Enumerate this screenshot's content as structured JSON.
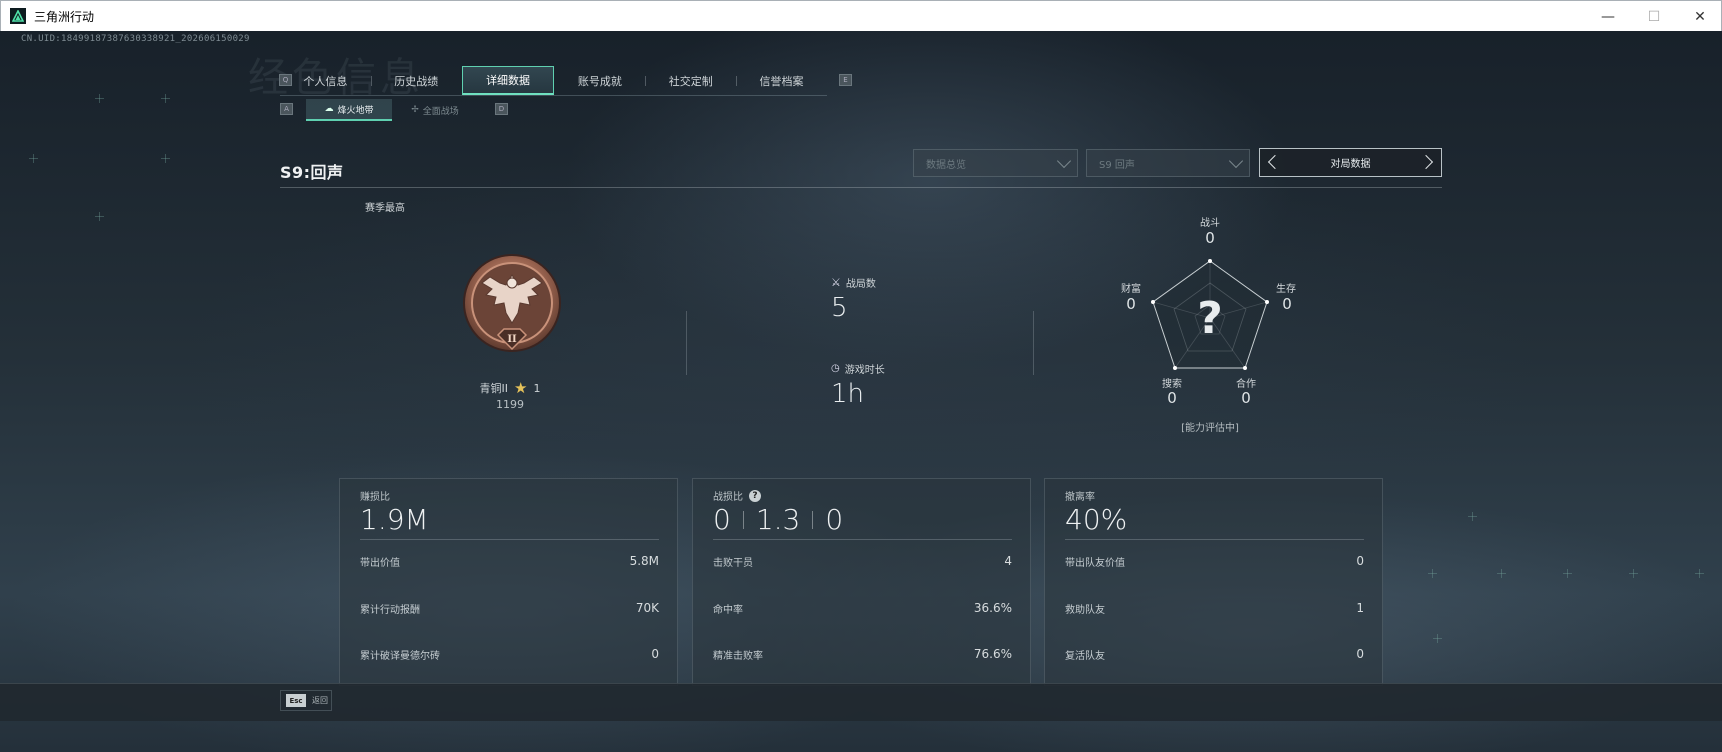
{
  "window": {
    "title": "三角洲行动",
    "minimize": "—",
    "maximize": "☐",
    "close": "✕"
  },
  "uid": "CN.UID:18499187387630338921_202606150029",
  "watermark": "经色信息",
  "main_tabs": [
    {
      "label": "个人信息"
    },
    {
      "label": "历史战绩"
    },
    {
      "label": "详细数据"
    },
    {
      "label": "账号成就"
    },
    {
      "label": "社交定制"
    },
    {
      "label": "信誉档案"
    }
  ],
  "key_hints": {
    "prev_tab": "Q",
    "next_tab": "E",
    "prev_sub": "A",
    "next_sub": "D"
  },
  "sub_tabs": [
    {
      "label": "烽火地带"
    },
    {
      "label": "全面战场"
    }
  ],
  "season": {
    "title": "S9:回声"
  },
  "filters": {
    "overview": "数据总览",
    "season": "S9 回声",
    "match_data": "对局数据"
  },
  "rank": {
    "season_best_label": "赛季最高",
    "name": "青铜II",
    "stars": "1",
    "score": "1199",
    "numeral": "II"
  },
  "summary": {
    "matches_label": "战局数",
    "matches_value": "5",
    "playtime_label": "游戏时长",
    "playtime_value": "1h"
  },
  "radar": {
    "combat_label": "战斗",
    "combat_value": "0",
    "survival_label": "生存",
    "survival_value": "0",
    "wealth_label": "财富",
    "wealth_value": "0",
    "search_label": "搜索",
    "search_value": "0",
    "teamwork_label": "合作",
    "teamwork_value": "0",
    "center_mark": "?",
    "note": "[能力评估中]"
  },
  "cards": {
    "profit": {
      "title": "赚损比",
      "value": "1.9M",
      "rows": [
        {
          "label": "带出价值",
          "value": "5.8M"
        },
        {
          "label": "累计行动报酬",
          "value": "70K"
        },
        {
          "label": "累计破译曼德尔砖",
          "value": "0"
        }
      ]
    },
    "kd": {
      "title": "战损比",
      "values": [
        "0",
        "1.3",
        "0"
      ],
      "rows": [
        {
          "label": "击败干员",
          "value": "4"
        },
        {
          "label": "命中率",
          "value": "36.6%"
        },
        {
          "label": "精准击败率",
          "value": "76.6%"
        }
      ]
    },
    "extract": {
      "title": "撤离率",
      "value": "40%",
      "rows": [
        {
          "label": "带出队友价值",
          "value": "0"
        },
        {
          "label": "救助队友",
          "value": "1"
        },
        {
          "label": "复活队友",
          "value": "0"
        }
      ]
    }
  },
  "footer": {
    "esc_key": "Esc",
    "back_label": "返回"
  },
  "colors": {
    "accent": "#5fd0b0",
    "bronze": "#a5715a"
  }
}
